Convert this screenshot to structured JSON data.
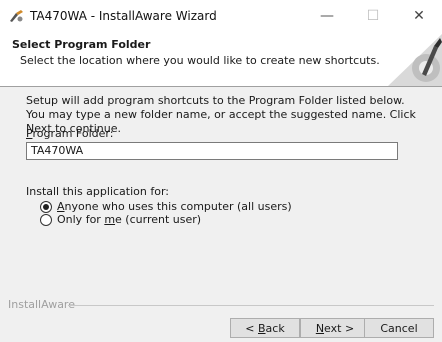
{
  "window": {
    "title": "TA470WA - InstallAware Wizard",
    "minimize_glyph": "—",
    "maximize_glyph": "☐",
    "close_glyph": "✕",
    "icon": "installer-app-icon"
  },
  "header": {
    "title": "Select Program Folder",
    "subtitle": "Select the location where you would like to create new shortcuts.",
    "graphic_icon": "installaware-logo-graphic"
  },
  "main": {
    "description": "Setup will add program shortcuts to the Program Folder listed below. You may type a new folder name, or accept the suggested name. Click Next to continue.",
    "program_folder_label_prefix": "",
    "program_folder_label_mnemonic": "P",
    "program_folder_label_rest": "rogram Folder:",
    "program_folder_value": "TA470WA",
    "install_for_label": "Install this application for:",
    "options": [
      {
        "mnemonic": "A",
        "rest": "nyone who uses this computer (all users)",
        "selected": true
      },
      {
        "prefix": "Only for ",
        "mnemonic": "m",
        "rest": "e (current user)",
        "selected": false
      }
    ]
  },
  "footer": {
    "brand": "InstallAware",
    "back": {
      "prefix": "< ",
      "mnemonic": "B",
      "rest": "ack"
    },
    "next": {
      "mnemonic": "N",
      "rest": "ext >"
    },
    "cancel": "Cancel"
  },
  "colors": {
    "window_bg": "#f0f0f0",
    "header_bg": "#ffffff",
    "button_bg": "#e1e1e1",
    "brand_text": "#a0a0a0"
  }
}
